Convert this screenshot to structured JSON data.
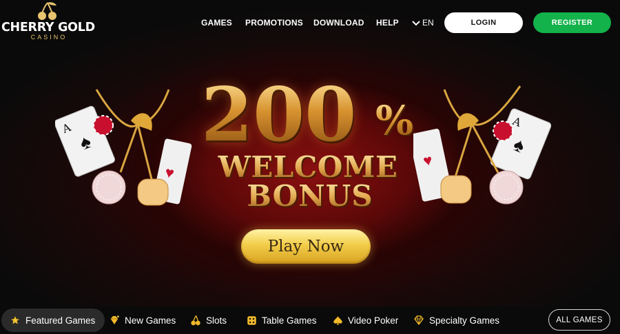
{
  "header": {
    "logo": {
      "main": "CHERRY GOLD",
      "sub": "CASINO"
    },
    "nav": [
      {
        "label": "GAMES"
      },
      {
        "label": "PROMOTIONS"
      },
      {
        "label": "DOWNLOAD"
      },
      {
        "label": "HELP"
      }
    ],
    "language": "EN",
    "login_label": "LOGIN",
    "register_label": "REGISTER"
  },
  "banner": {
    "amount": "200",
    "percent": "%",
    "line2": "WELCOME",
    "line3": "BONUS",
    "cta_label": "Play Now"
  },
  "categories": [
    {
      "label": "Featured Games",
      "icon": "star-icon",
      "active": true
    },
    {
      "label": "New Games",
      "icon": "gem-sparkle-icon"
    },
    {
      "label": "Slots",
      "icon": "cherries-icon"
    },
    {
      "label": "Table Games",
      "icon": "dice-icon"
    },
    {
      "label": "Video Poker",
      "icon": "spade-icon"
    },
    {
      "label": "Specialty Games",
      "icon": "diamond-icon"
    }
  ],
  "all_games_label": "ALL GAMES",
  "colors": {
    "accent_gold": "#e7a747",
    "register_green": "#13b24a",
    "background": "#0a0a0a",
    "hero_red": "#8a1010"
  }
}
